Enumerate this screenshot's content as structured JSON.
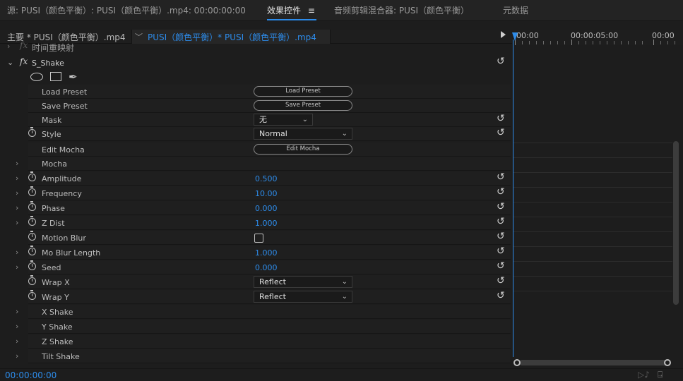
{
  "tabs": [
    {
      "label": "源: PUSI（颜色平衡）: PUSI（颜色平衡）.mp4: 00:00:00:00",
      "active": false
    },
    {
      "label": "效果控件",
      "active": true
    },
    {
      "label": "音频剪辑混合器: PUSI（颜色平衡）",
      "active": false
    },
    {
      "label": "元数据",
      "active": false
    }
  ],
  "menu_icon": "≡",
  "sequence": {
    "main": "主要 * PUSI（颜色平衡）.mp4",
    "clip": "PUSI（颜色平衡）* PUSI（颜色平衡）.mp4"
  },
  "timeline": {
    "tc_start": "00:00",
    "tc_mid": "00:00:05:00",
    "tc_end": "00:00"
  },
  "previous_effect": {
    "name": "时间重映射"
  },
  "effect": {
    "fx": "fx",
    "name": "S_Shake"
  },
  "properties": [
    {
      "label": "Load Preset",
      "kind": "button",
      "button": "Load Preset"
    },
    {
      "label": "Save Preset",
      "kind": "button",
      "button": "Save Preset"
    },
    {
      "label": "Mask",
      "kind": "dropdown",
      "value": "无",
      "reset": true
    },
    {
      "label": "Style",
      "kind": "dropdown",
      "value": "Normal",
      "stopwatch": true,
      "reset": true
    },
    {
      "label": "Edit Mocha",
      "kind": "button",
      "button": "Edit Mocha"
    },
    {
      "label": "Mocha",
      "kind": "group"
    },
    {
      "label": "Amplitude",
      "kind": "number",
      "value": "0.500",
      "stopwatch": true,
      "expand": true,
      "reset": true
    },
    {
      "label": "Frequency",
      "kind": "number",
      "value": "10.00",
      "stopwatch": true,
      "expand": true,
      "reset": true
    },
    {
      "label": "Phase",
      "kind": "number",
      "value": "0.000",
      "stopwatch": true,
      "expand": true,
      "reset": true
    },
    {
      "label": "Z Dist",
      "kind": "number",
      "value": "1.000",
      "stopwatch": true,
      "expand": true,
      "reset": true
    },
    {
      "label": "Motion Blur",
      "kind": "checkbox",
      "stopwatch": true,
      "reset": true
    },
    {
      "label": "Mo Blur Length",
      "kind": "number",
      "value": "1.000",
      "stopwatch": true,
      "expand": true,
      "reset": true
    },
    {
      "label": "Seed",
      "kind": "number",
      "value": "0.000",
      "stopwatch": true,
      "expand": true,
      "reset": true
    },
    {
      "label": "Wrap X",
      "kind": "dropdown",
      "value": "Reflect",
      "stopwatch": true,
      "reset": true
    },
    {
      "label": "Wrap Y",
      "kind": "dropdown",
      "value": "Reflect",
      "stopwatch": true,
      "reset": true
    },
    {
      "label": "X Shake",
      "kind": "group"
    },
    {
      "label": "Y Shake",
      "kind": "group"
    },
    {
      "label": "Z Shake",
      "kind": "group"
    },
    {
      "label": "Tilt Shake",
      "kind": "group"
    }
  ],
  "current_timecode": "00:00:00:00",
  "colors": {
    "accent": "#2d8ceb",
    "panel": "#1d1d1d",
    "text": "#bdbdbd"
  }
}
